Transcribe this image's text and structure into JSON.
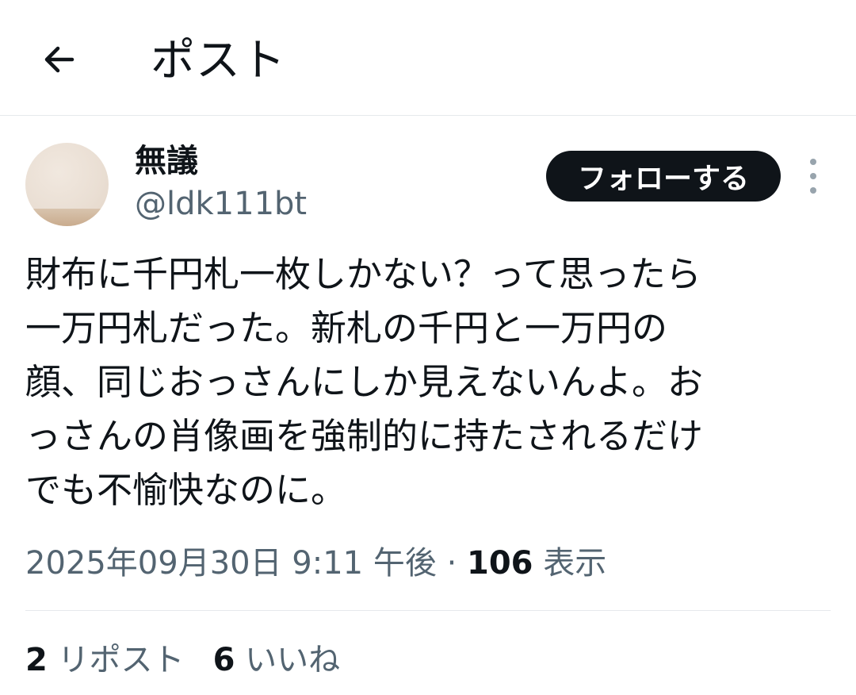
{
  "header": {
    "title": "ポスト",
    "back_icon": "arrow-left-icon"
  },
  "author": {
    "display_name": "無議",
    "handle": "@ldk111bt",
    "follow_label": "フォローする",
    "more_icon": "more-vertical-icon"
  },
  "post": {
    "text": "財布に千円札一枚しかない？って思ったら\n一万円札だった。新札の千円と一万円の\n顔、同じおっさんにしか見えないんよ。お\nっさんの肖像画を強制的に持たされるだけ\nでも不愉快なのに。"
  },
  "meta": {
    "timestamp": "2025年09月30日 9:11 午後",
    "separator": "·",
    "views_count": "106",
    "views_label": "表示"
  },
  "stats": {
    "reposts_count": "2",
    "reposts_label": "リポスト",
    "likes_count": "6",
    "likes_label": "いいね"
  },
  "colors": {
    "text_primary": "#0f1419",
    "text_secondary": "#536471",
    "border": "#e6e9ec",
    "follow_bg": "#0f1419"
  }
}
